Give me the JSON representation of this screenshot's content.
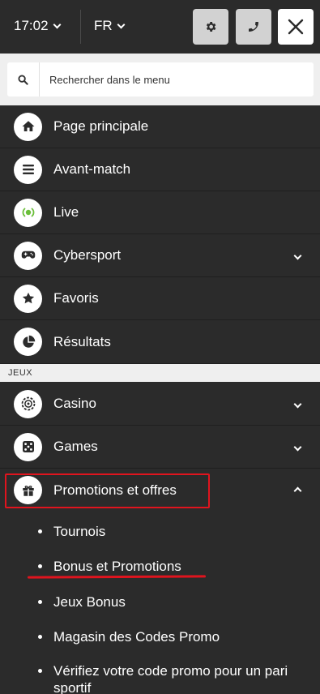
{
  "header": {
    "time": "17:02",
    "language": "FR"
  },
  "search": {
    "placeholder": "Rechercher dans le menu"
  },
  "menu": {
    "items": [
      {
        "label": "Page principale",
        "icon": "home-icon"
      },
      {
        "label": "Avant-match",
        "icon": "list-icon"
      },
      {
        "label": "Live",
        "icon": "live-icon"
      },
      {
        "label": "Cybersport",
        "icon": "gamepad-icon"
      },
      {
        "label": "Favoris",
        "icon": "star-icon"
      },
      {
        "label": "Résultats",
        "icon": "pie-chart-icon"
      }
    ],
    "section_label": "JEUX",
    "games": [
      {
        "label": "Casino",
        "icon": "casino-chip-icon"
      },
      {
        "label": "Games",
        "icon": "dice-icon"
      },
      {
        "label": "Promotions et offres",
        "icon": "gift-icon"
      }
    ],
    "promotions": [
      {
        "label": "Tournois"
      },
      {
        "label": "Bonus et Promotions"
      },
      {
        "label": "Jeux Bonus"
      },
      {
        "label": "Magasin des Codes Promo"
      },
      {
        "label": "Vérifiez votre code promo pour un pari sportif"
      }
    ]
  },
  "colors": {
    "background": "#2b2b2b",
    "accent_red": "#e0141e",
    "live_green": "#6abe39",
    "search_bg": "#efefef"
  }
}
